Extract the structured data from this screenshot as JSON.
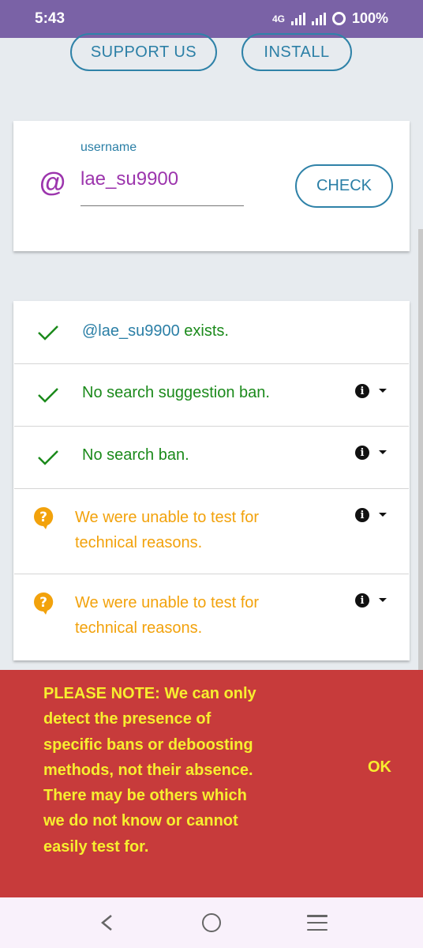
{
  "status_bar": {
    "time": "5:43",
    "network": "4G",
    "battery": "100%"
  },
  "header": {
    "support_label": "SUPPORT US",
    "install_label": "INSTALL"
  },
  "form": {
    "field_label": "username",
    "at_symbol": "@",
    "username_value": "lae_su9900",
    "check_label": "CHECK"
  },
  "results": [
    {
      "status": "ok",
      "user_ref": "@lae_su9900",
      "text": " exists.",
      "has_info": false
    },
    {
      "status": "ok",
      "text": "No search suggestion ban.",
      "has_info": true
    },
    {
      "status": "ok",
      "text": "No search ban.",
      "has_info": true
    },
    {
      "status": "unknown",
      "line1": "We were unable to test for",
      "line2": "technical reasons.",
      "has_info": true
    },
    {
      "status": "unknown",
      "line1": "We were unable to test for",
      "line2": "technical reasons.",
      "has_info": true
    }
  ],
  "notice": {
    "lines": [
      "PLEASE NOTE: We can only",
      "detect the presence of",
      "specific bans or deboosting",
      "methods, not their absence.",
      "There may be others which",
      "we do not know or cannot",
      "easily test for."
    ],
    "ok_label": "OK"
  },
  "colors": {
    "status_bar": "#7a62a6",
    "accent_blue": "#2b7fa6",
    "username_purple": "#9c35ad",
    "ok_green": "#1b8a1b",
    "warn_orange": "#f2a20c",
    "notice_red": "#c73b3b",
    "notice_yellow": "#f7ee2f"
  },
  "icons": {
    "ok": "check-icon",
    "unknown": "question-bubble-icon",
    "info": "info-icon",
    "expand": "caret-down-icon"
  }
}
